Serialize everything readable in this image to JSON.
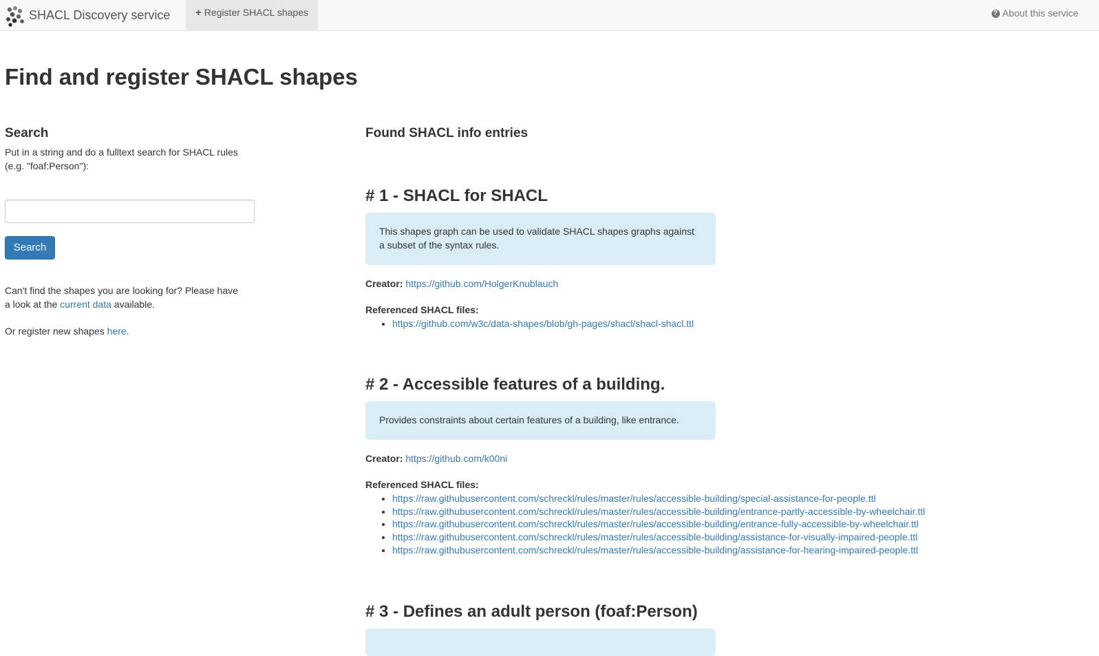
{
  "navbar": {
    "brand": "SHACL Discovery service",
    "register": "Register SHACL shapes",
    "about": "About this service"
  },
  "page_title": "Find and register SHACL shapes",
  "search": {
    "heading": "Search",
    "description": "Put in a string and do a fulltext search for SHACL rules (e.g. \"foaf:Person\"):",
    "input_value": "",
    "button": "Search",
    "hint_prefix": "Can't find the shapes you are looking for? Please have a look at the ",
    "hint_link": "current data",
    "hint_suffix": " available.",
    "register_prefix": "Or register new shapes ",
    "register_link": "here",
    "register_suffix": "."
  },
  "results": {
    "heading": "Found SHACL info entries",
    "creator_label": "Creator:",
    "files_label": "Referenced SHACL files:",
    "entries": [
      {
        "title": "# 1 - SHACL for SHACL",
        "description": "This shapes graph can be used to validate SHACL shapes graphs against a subset of the syntax rules.",
        "creator": "https://github.com/HolgerKnublauch",
        "files": [
          "https://github.com/w3c/data-shapes/blob/gh-pages/shacl/shacl-shacl.ttl"
        ]
      },
      {
        "title": "# 2 - Accessible features of a building.",
        "description": "Provides constraints about certain features of a building, like entrance.",
        "creator": "https://github.com/k00ni",
        "files": [
          "https://raw.githubusercontent.com/schreckl/rules/master/rules/accessible-building/special-assistance-for-people.ttl",
          "https://raw.githubusercontent.com/schreckl/rules/master/rules/accessible-building/entrance-partly-accessible-by-wheelchair.ttl",
          "https://raw.githubusercontent.com/schreckl/rules/master/rules/accessible-building/entrance-fully-accessible-by-wheelchair.ttl",
          "https://raw.githubusercontent.com/schreckl/rules/master/rules/accessible-building/assistance-for-visually-impaired-people.ttl",
          "https://raw.githubusercontent.com/schreckl/rules/master/rules/accessible-building/assistance-for-hearing-impaired-people.ttl"
        ]
      },
      {
        "title": "# 3 - Defines an adult person (foaf:Person)"
      }
    ]
  }
}
